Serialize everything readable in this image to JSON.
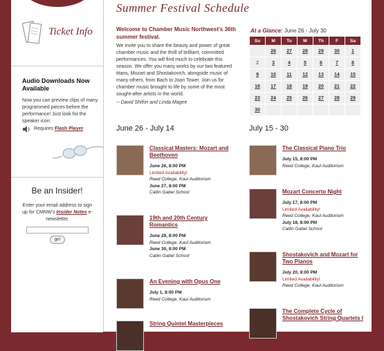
{
  "sidebar": {
    "ticket_info": "Ticket Info",
    "audio": {
      "title": "Audio Downloads Now Available",
      "desc": "Now you can preview clips of many programmed pieces before the performance! Just look for the speaker icon:",
      "requires": "Requires",
      "flash": "Flash Player"
    },
    "insider": {
      "title_prefix": "Be an",
      "title_word": "Insider!",
      "desc_1": "Enter your email address to sign up for CMNW's",
      "notes_link": "Insider Notes",
      "desc_2": "e-newsletter.",
      "go": "go!"
    }
  },
  "main": {
    "title": "Summer Festival Schedule",
    "welcome": "Welcome to Chamber Music Northwest's 36th summer festival.",
    "intro": "We invite you to share the beauty and power of great chamber music and the thrill of brilliant, committed performances. You will find much to celebrate this season. We offer you many works by our two featured titans, Mozart and Shostakovich, alongside music of many others, from Bach to Joan Tower. Join us for chamber music brought to life by some of the most sought-after artists in the world.",
    "signature": "-- David Shifrin and Linda Magee",
    "glance_label": "At a Glance:",
    "glance_range": "June 26 - July 30",
    "calendar": {
      "days": [
        "Su",
        "M",
        "Tu",
        "W",
        "Th",
        "F",
        "Sa"
      ],
      "weeks": [
        [
          {
            "d": "",
            "l": false
          },
          {
            "d": "26",
            "l": true
          },
          {
            "d": "27",
            "l": true
          },
          {
            "d": "28",
            "l": true
          },
          {
            "d": "29",
            "l": true
          },
          {
            "d": "30",
            "l": true
          },
          {
            "d": "1",
            "l": true
          }
        ],
        [
          {
            "d": "2",
            "l": false
          },
          {
            "d": "3",
            "l": true
          },
          {
            "d": "4",
            "l": true
          },
          {
            "d": "5",
            "l": true
          },
          {
            "d": "6",
            "l": true
          },
          {
            "d": "7",
            "l": true
          },
          {
            "d": "8",
            "l": true
          }
        ],
        [
          {
            "d": "9",
            "l": true
          },
          {
            "d": "10",
            "l": true
          },
          {
            "d": "11",
            "l": true
          },
          {
            "d": "12",
            "l": true
          },
          {
            "d": "13",
            "l": true
          },
          {
            "d": "14",
            "l": true
          },
          {
            "d": "15",
            "l": true
          }
        ],
        [
          {
            "d": "16",
            "l": true
          },
          {
            "d": "17",
            "l": true
          },
          {
            "d": "18",
            "l": true
          },
          {
            "d": "19",
            "l": true
          },
          {
            "d": "20",
            "l": true
          },
          {
            "d": "21",
            "l": true
          },
          {
            "d": "22",
            "l": true
          }
        ],
        [
          {
            "d": "23",
            "l": true
          },
          {
            "d": "24",
            "l": true
          },
          {
            "d": "25",
            "l": true
          },
          {
            "d": "26",
            "l": true
          },
          {
            "d": "27",
            "l": true
          },
          {
            "d": "28",
            "l": true
          },
          {
            "d": "29",
            "l": true
          }
        ],
        [
          {
            "d": "30",
            "l": true
          },
          {
            "d": "",
            "l": false
          },
          {
            "d": "",
            "l": false
          },
          {
            "d": "",
            "l": false
          },
          {
            "d": "",
            "l": false
          },
          {
            "d": "",
            "l": false
          },
          {
            "d": "",
            "l": false
          }
        ]
      ]
    },
    "left_heading": "June 26 - July 14",
    "right_heading": "July 15 - 30",
    "left_events": [
      {
        "title": "Classical Masters: Mozart and Beethoven",
        "lines": [
          {
            "t": "June 26, 8:00 PM",
            "k": "d"
          },
          {
            "t": "Limited Availability!",
            "k": "lim"
          },
          {
            "t": "Reed College, Kaul Auditorium",
            "k": "v"
          },
          {
            "t": "June 27, 8:00 PM",
            "k": "d"
          },
          {
            "t": "Catlin Gabel School",
            "k": "v"
          }
        ]
      },
      {
        "title": "19th and 20th Century Romantics",
        "lines": [
          {
            "t": "June 29, 8:00 PM",
            "k": "d"
          },
          {
            "t": "Reed College, Kaul Auditorium",
            "k": "v"
          },
          {
            "t": "June 30, 8:00 PM",
            "k": "d"
          },
          {
            "t": "Catlin Gabel School",
            "k": "v"
          }
        ]
      },
      {
        "title": "An Evening with Opus One",
        "lines": [
          {
            "t": "July 1, 8:00 PM",
            "k": "d"
          },
          {
            "t": "Reed College, Kaul Auditorium",
            "k": "v"
          }
        ]
      },
      {
        "title": "String Quintet Masterpieces",
        "lines": []
      }
    ],
    "right_events": [
      {
        "title": "The Classical Piano Trio",
        "lines": [
          {
            "t": "July 15, 8:00 PM",
            "k": "d"
          },
          {
            "t": "Reed College, Kaul Auditorium",
            "k": "v"
          }
        ]
      },
      {
        "title": "Mozart Concerto Night",
        "lines": [
          {
            "t": "July 17, 8:00 PM",
            "k": "d"
          },
          {
            "t": "Limited Availability!",
            "k": "lim"
          },
          {
            "t": "Reed College, Kaul Auditorium",
            "k": "v"
          },
          {
            "t": "July 18, 8:00 PM",
            "k": "d"
          },
          {
            "t": "Catlin Gabel School",
            "k": "v"
          }
        ]
      },
      {
        "title": "Shostakovich and Mozart for Two Pianos",
        "lines": [
          {
            "t": "July 20, 8:00 PM",
            "k": "d"
          },
          {
            "t": "Limited Availability!",
            "k": "lim"
          },
          {
            "t": "Reed College, Kaul Auditorium",
            "k": "v"
          }
        ]
      },
      {
        "title": "The Complete Cycle of Shostakovich String Quartets I",
        "lines": []
      }
    ]
  },
  "colors": {
    "brand": "#7a2a2e",
    "limited": "#b01818"
  }
}
